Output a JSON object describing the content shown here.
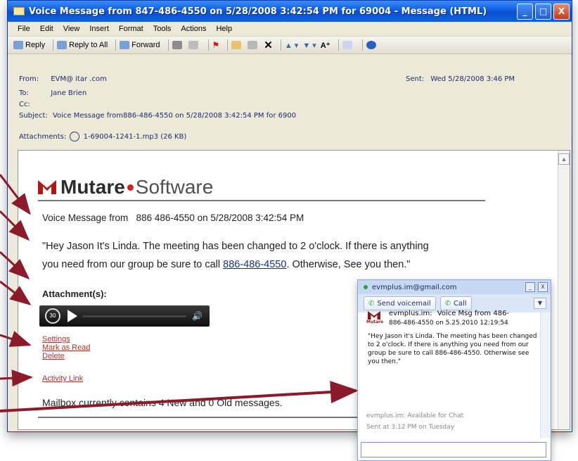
{
  "window": {
    "title": "Voice Message from 847-486-4550 on 5/28/2008 3:42:54 PM for 69004 - Message (HTML)",
    "controls": [
      "_",
      "□",
      "X"
    ]
  },
  "menu": [
    "File",
    "Edit",
    "View",
    "Insert",
    "Format",
    "Tools",
    "Actions",
    "Help"
  ],
  "toolbar": {
    "reply": "Reply",
    "reply_all": "Reply to All",
    "forward": "Forward"
  },
  "header": {
    "from_label": "From:",
    "from_value": "EVM@ itar .com",
    "to_label": "To:",
    "to_value": "Jane Brien",
    "cc_label": "Cc:",
    "subject_label": "Subject:",
    "subject_value": "Voice Message from886-486-4550 on 5/28/2008 3:42:54 PM for 6900",
    "attachments_label": "Attachments:",
    "attachment_file": "1-69004-1241-1.mp3 (26 KB)",
    "sent_label": "Sent:",
    "sent_value": "Wed 5/28/2008 3:46 PM"
  },
  "body": {
    "logo_word1": "Mutare",
    "logo_word2": "Software",
    "voice_line": "Voice Message from   886 486-4550 on 5/28/2008 3:42:54 PM",
    "quote_line1": "\"Hey Jason It's Linda. The meeting has been changed to 2 o'clock. If there is anything",
    "quote_line2_a": "you  need from our group be sure to call ",
    "quote_phone": "886-486-4550",
    "quote_line2_b": ". Otherwise, See you then.\"",
    "attachments_heading": "Attachment(s):",
    "player_rewind": "30",
    "links": [
      "Settings",
      "Mark as Read",
      "Delete"
    ],
    "activity_link": "Activity Link",
    "mailbox": "Mailbox currently contains 4 New and 0 Old messages."
  },
  "chat": {
    "title": "evmplus.im@gmail.com",
    "send_voicemail": "Send voicemail",
    "call": "Call",
    "logo_text": "Mutare",
    "sender": "evmplus.im:",
    "sender_msg": "Voice Msg from 486-",
    "line2": "886-486-4550 on 5.25.2010 12:19:54",
    "quote": "\"Hey Jason it's Linda. The meeting has been changed to 2 o'clock. If there is anything you need from our group be sure to call 886-486-4550. Otherwise see you then.\"",
    "status": "evmplus.im: Available for Chat",
    "sent_time": "Sent at 3:12 PM on Tuesday"
  },
  "colors": {
    "arrow": "#8b1a2a",
    "title_blue": "#0b5ee3",
    "link_red": "#b33326",
    "logo_red": "#d22121"
  }
}
